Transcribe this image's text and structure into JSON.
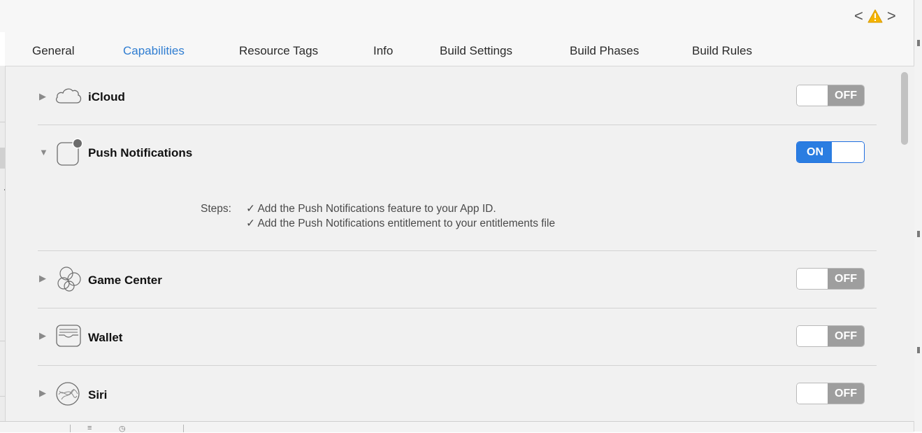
{
  "window": {
    "nav_back": "<",
    "nav_forward": ">",
    "warning_icon": "warning-triangle-icon"
  },
  "tabs": [
    {
      "label": "General",
      "active": false
    },
    {
      "label": "Capabilities",
      "active": true
    },
    {
      "label": "Resource Tags",
      "active": false
    },
    {
      "label": "Info",
      "active": false
    },
    {
      "label": "Build Settings",
      "active": false
    },
    {
      "label": "Build Phases",
      "active": false
    },
    {
      "label": "Build Rules",
      "active": false
    }
  ],
  "capabilities": [
    {
      "name": "iCloud",
      "icon": "cloud-icon",
      "expanded": false,
      "enabled": false,
      "toggle_label": "OFF"
    },
    {
      "name": "Push Notifications",
      "icon": "push-notifications-icon",
      "expanded": true,
      "enabled": true,
      "toggle_label": "ON",
      "steps_label": "Steps:",
      "steps": [
        {
          "check": "✓",
          "text": "Add the Push Notifications feature to your App ID."
        },
        {
          "check": "✓",
          "text": "Add the Push Notifications entitlement to your entitlements file"
        }
      ]
    },
    {
      "name": "Game Center",
      "icon": "game-center-icon",
      "expanded": false,
      "enabled": false,
      "toggle_label": "OFF"
    },
    {
      "name": "Wallet",
      "icon": "wallet-icon",
      "expanded": false,
      "enabled": false,
      "toggle_label": "OFF"
    },
    {
      "name": "Siri",
      "icon": "siri-icon",
      "expanded": false,
      "enabled": false,
      "toggle_label": "OFF"
    }
  ],
  "disclosure": {
    "collapsed": "▶",
    "expanded": "▼"
  },
  "colors": {
    "accent": "#2f7dd1",
    "toggle_on": "#2a7de1",
    "toggle_off": "#9e9e9e",
    "warning": "#f5b400"
  }
}
